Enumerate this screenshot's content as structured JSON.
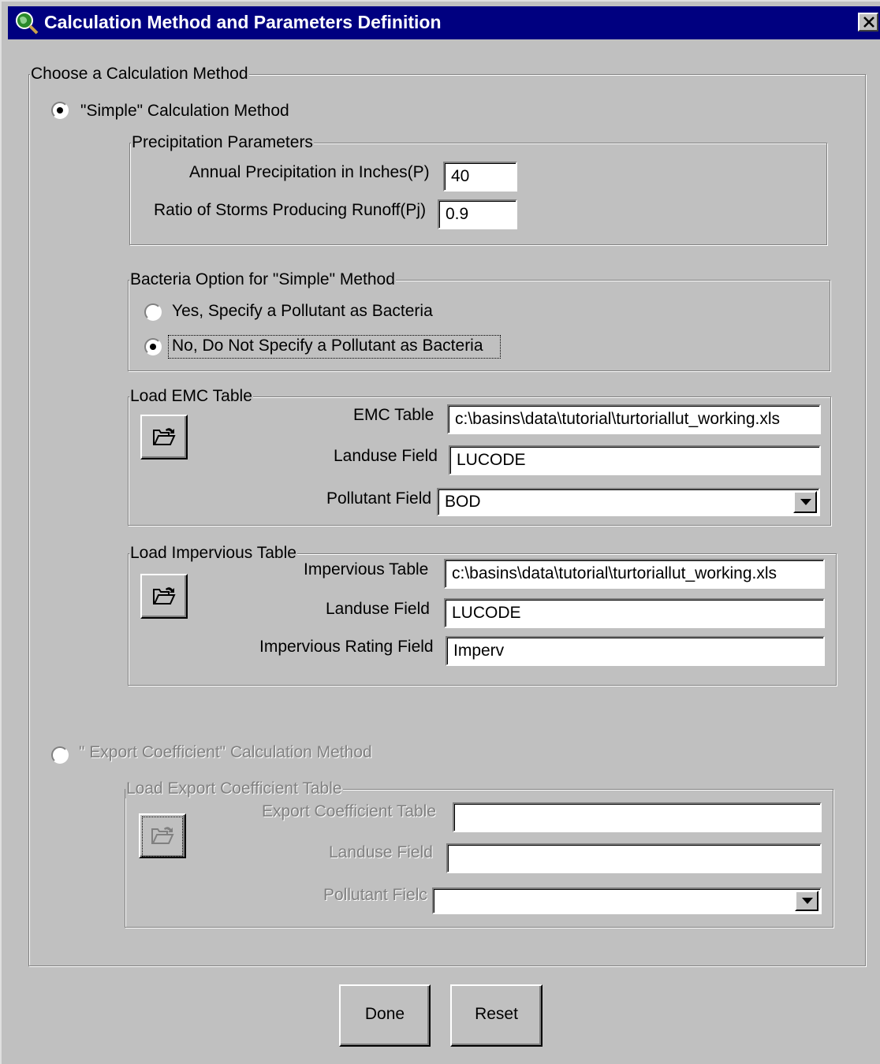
{
  "window": {
    "title": "Calculation Method and Parameters Definition"
  },
  "method_group": {
    "legend": "Choose a Calculation Method"
  },
  "simple": {
    "label": "\"Simple\" Calculation Method",
    "selected": true,
    "precip": {
      "legend": "Precipitation Parameters",
      "annual_label": "Annual Precipitation in Inches(P)",
      "annual_value": "40",
      "ratio_label": "Ratio of Storms Producing Runoff(Pj)",
      "ratio_value": "0.9"
    },
    "bacteria": {
      "legend": "Bacteria Option for \"Simple\" Method",
      "yes_label": "Yes, Specify a Pollutant as Bacteria",
      "no_label": "No, Do Not Specify a Pollutant as Bacteria",
      "selected": "no"
    },
    "emc": {
      "legend": "Load EMC Table",
      "table_label": "EMC Table",
      "table_value": "c:\\basins\\data\\tutorial\\turtoriallut_working.xls",
      "landuse_label": "Landuse Field",
      "landuse_value": "LUCODE",
      "pollutant_label": "Pollutant Field",
      "pollutant_value": "BOD"
    },
    "impervious": {
      "legend": "Load Impervious Table",
      "table_label": "Impervious Table",
      "table_value": "c:\\basins\\data\\tutorial\\turtoriallut_working.xls",
      "landuse_label": "Landuse Field",
      "landuse_value": "LUCODE",
      "rating_label": "Impervious Rating Field",
      "rating_value": "Imperv"
    }
  },
  "export": {
    "label": "\" Export Coefficient\" Calculation Method",
    "selected": false,
    "enabled": false,
    "group": {
      "legend": "Load Export Coefficient Table",
      "table_label": "Export Coefficient Table",
      "table_value": "",
      "landuse_label": "Landuse Field",
      "landuse_value": "",
      "pollutant_label": "Pollutant Fielc",
      "pollutant_value": ""
    }
  },
  "buttons": {
    "done": "Done",
    "reset": "Reset"
  },
  "icons": {
    "title": "globe-magnifier-icon",
    "close": "close-icon",
    "folder": "open-folder-icon",
    "dropdown": "chevron-down-icon"
  }
}
